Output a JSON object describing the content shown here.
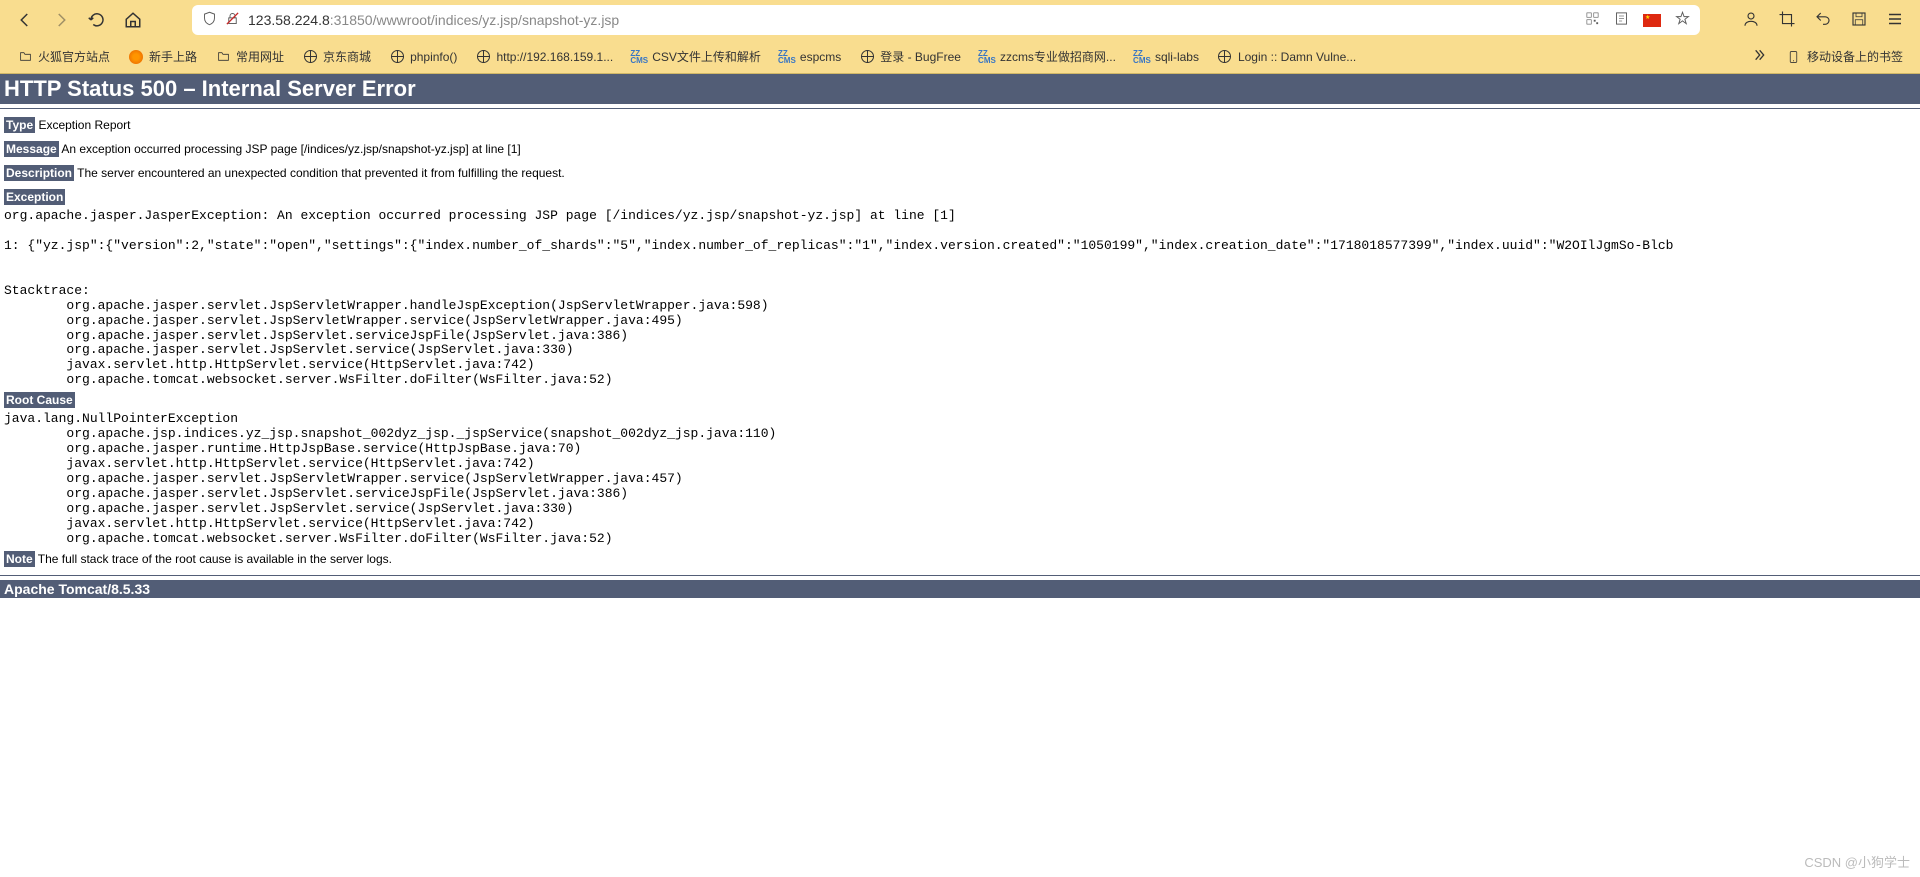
{
  "browser": {
    "url_display_host": "123.58.224.8",
    "url_display_port_path": ":31850/wwwroot/indices/yz.jsp/snapshot-yz.jsp"
  },
  "bookmarks": {
    "items": [
      {
        "label": "火狐官方站点",
        "icon": "folder"
      },
      {
        "label": "新手上路",
        "icon": "firefox"
      },
      {
        "label": "常用网址",
        "icon": "folder"
      },
      {
        "label": "京东商城",
        "icon": "globe"
      },
      {
        "label": "phpinfo()",
        "icon": "globe"
      },
      {
        "label": "http://192.168.159.1...",
        "icon": "globe"
      },
      {
        "label": "CSV文件上传和解析",
        "icon": "zz"
      },
      {
        "label": "espcms",
        "icon": "zz"
      },
      {
        "label": "登录 - BugFree",
        "icon": "globe"
      },
      {
        "label": "zzcms专业做招商网...",
        "icon": "zz"
      },
      {
        "label": "sqli-labs",
        "icon": "zz"
      },
      {
        "label": "Login :: Damn Vulne...",
        "icon": "globe"
      }
    ],
    "right_label": "移动设备上的书签"
  },
  "page": {
    "h1": "HTTP Status 500 – Internal Server Error",
    "type_label": "Type",
    "type_value": " Exception Report",
    "message_label": "Message",
    "message_value": " An exception occurred processing JSP page [/indices/yz.jsp/snapshot-yz.jsp] at line [1]",
    "description_label": "Description",
    "description_value": " The server encountered an unexpected condition that prevented it from fulfilling the request.",
    "exception_label": "Exception",
    "exception_pre": "org.apache.jasper.JasperException: An exception occurred processing JSP page [/indices/yz.jsp/snapshot-yz.jsp] at line [1]\n\n1: {\"yz.jsp\":{\"version\":2,\"state\":\"open\",\"settings\":{\"index.number_of_shards\":\"5\",\"index.number_of_replicas\":\"1\",\"index.version.created\":\"1050199\",\"index.creation_date\":\"1718018577399\",\"index.uuid\":\"W2OIlJgmSo-Blcb\n\n\nStacktrace:\n\torg.apache.jasper.servlet.JspServletWrapper.handleJspException(JspServletWrapper.java:598)\n\torg.apache.jasper.servlet.JspServletWrapper.service(JspServletWrapper.java:495)\n\torg.apache.jasper.servlet.JspServlet.serviceJspFile(JspServlet.java:386)\n\torg.apache.jasper.servlet.JspServlet.service(JspServlet.java:330)\n\tjavax.servlet.http.HttpServlet.service(HttpServlet.java:742)\n\torg.apache.tomcat.websocket.server.WsFilter.doFilter(WsFilter.java:52)",
    "root_cause_label": "Root Cause",
    "root_cause_pre": "java.lang.NullPointerException\n\torg.apache.jsp.indices.yz_jsp.snapshot_002dyz_jsp._jspService(snapshot_002dyz_jsp.java:110)\n\torg.apache.jasper.runtime.HttpJspBase.service(HttpJspBase.java:70)\n\tjavax.servlet.http.HttpServlet.service(HttpServlet.java:742)\n\torg.apache.jasper.servlet.JspServletWrapper.service(JspServletWrapper.java:457)\n\torg.apache.jasper.servlet.JspServlet.serviceJspFile(JspServlet.java:386)\n\torg.apache.jasper.servlet.JspServlet.service(JspServlet.java:330)\n\tjavax.servlet.http.HttpServlet.service(HttpServlet.java:742)\n\torg.apache.tomcat.websocket.server.WsFilter.doFilter(WsFilter.java:52)",
    "note_label": "Note",
    "note_value": " The full stack trace of the root cause is available in the server logs.",
    "footer": "Apache Tomcat/8.5.33"
  },
  "watermark": "CSDN @小狗学士"
}
